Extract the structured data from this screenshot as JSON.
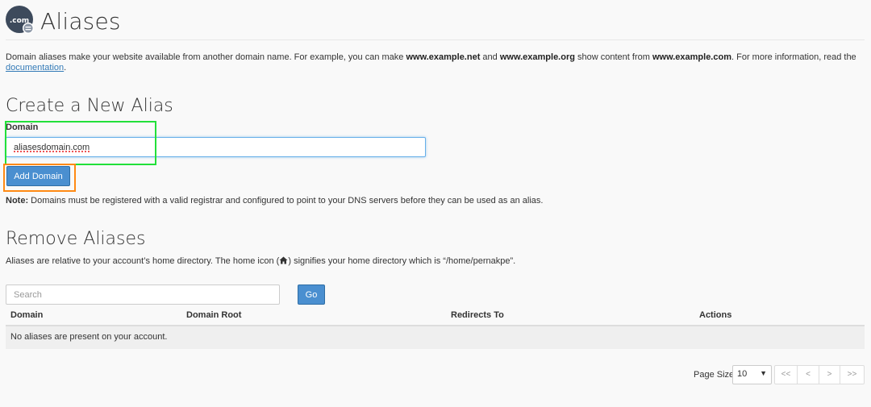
{
  "header": {
    "title": "Aliases",
    "icon_text": ".com"
  },
  "intro": {
    "text_1": "Domain aliases make your website available from another domain name. For example, you can make ",
    "bold_1": "www.example.net",
    "text_2": " and ",
    "bold_2": "www.example.org",
    "text_3": " show content from ",
    "bold_3": "www.example.com",
    "text_4": ". For more information, read the ",
    "link": "documentation",
    "text_5": "."
  },
  "create": {
    "heading": "Create a New Alias",
    "domain_label": "Domain",
    "domain_value": "aliasesdomain.com",
    "add_button": "Add Domain",
    "note_label": "Note:",
    "note_text": " Domains must be registered with a valid registrar and configured to point to your DNS servers before they can be used as an alias."
  },
  "remove": {
    "heading": "Remove Aliases",
    "desc_1": "Aliases are relative to your account’s home directory. The home icon (",
    "desc_2": ") signifies your home directory which is “/home/pernakpe”.",
    "search_placeholder": "Search",
    "go_button": "Go"
  },
  "table": {
    "columns": [
      "Domain",
      "Domain Root",
      "Redirects To",
      "Actions"
    ],
    "empty_message": "No aliases are present on your account."
  },
  "pagination": {
    "page_size_label": "Page Size",
    "page_size_value": "10",
    "first": "<<",
    "prev": "<",
    "next": ">",
    "last": ">>"
  },
  "colors": {
    "accent": "#4a8fd0",
    "highlight_green": "#22e03a",
    "highlight_orange": "#ff8a14"
  }
}
